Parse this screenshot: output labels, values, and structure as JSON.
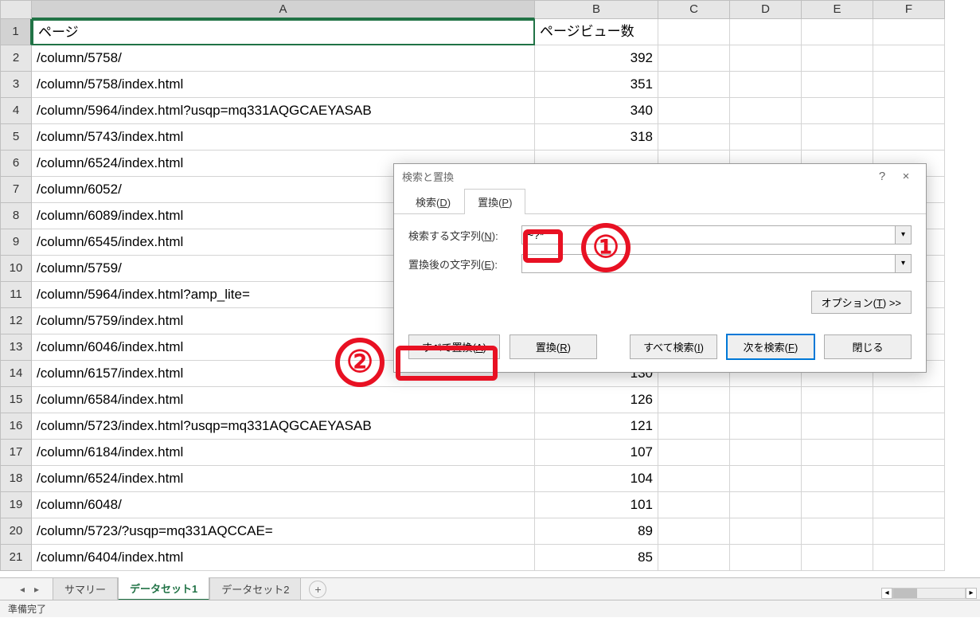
{
  "columns": [
    "A",
    "B",
    "C",
    "D",
    "E",
    "F"
  ],
  "rows": [
    {
      "n": 1,
      "a": "ページ",
      "b": "ページビュー数",
      "b_align": "left"
    },
    {
      "n": 2,
      "a": "/column/5758/",
      "b": "392"
    },
    {
      "n": 3,
      "a": "/column/5758/index.html",
      "b": "351"
    },
    {
      "n": 4,
      "a": "/column/5964/index.html?usqp=mq331AQGCAEYASAB",
      "b": "340"
    },
    {
      "n": 5,
      "a": "/column/5743/index.html",
      "b": "318"
    },
    {
      "n": 6,
      "a": "/column/6524/index.html",
      "b": ""
    },
    {
      "n": 7,
      "a": "/column/6052/",
      "b": ""
    },
    {
      "n": 8,
      "a": "/column/6089/index.html",
      "b": ""
    },
    {
      "n": 9,
      "a": "/column/6545/index.html",
      "b": ""
    },
    {
      "n": 10,
      "a": "/column/5759/",
      "b": ""
    },
    {
      "n": 11,
      "a": "/column/5964/index.html?amp_lite=",
      "b": ""
    },
    {
      "n": 12,
      "a": "/column/5759/index.html",
      "b": ""
    },
    {
      "n": 13,
      "a": "/column/6046/index.html",
      "b": ""
    },
    {
      "n": 14,
      "a": "/column/6157/index.html",
      "b": "130"
    },
    {
      "n": 15,
      "a": "/column/6584/index.html",
      "b": "126"
    },
    {
      "n": 16,
      "a": "/column/5723/index.html?usqp=mq331AQGCAEYASAB",
      "b": "121"
    },
    {
      "n": 17,
      "a": "/column/6184/index.html",
      "b": "107"
    },
    {
      "n": 18,
      "a": "/column/6524/index.html",
      "b": "104"
    },
    {
      "n": 19,
      "a": "/column/6048/",
      "b": "101"
    },
    {
      "n": 20,
      "a": "/column/5723/?usqp=mq331AQCCAE=",
      "b": "89"
    },
    {
      "n": 21,
      "a": "/column/6404/index.html",
      "b": "85"
    }
  ],
  "tabs": [
    {
      "label": "サマリー",
      "active": false
    },
    {
      "label": "データセット1",
      "active": true
    },
    {
      "label": "データセット2",
      "active": false
    }
  ],
  "status": "準備完了",
  "dialog": {
    "title": "検索と置換",
    "help": "?",
    "close": "×",
    "tabs": [
      {
        "label": "検索(D)",
        "key": "D",
        "active": false
      },
      {
        "label": "置換(P)",
        "key": "P",
        "active": true
      }
    ],
    "find_label": "検索する文字列(N):",
    "find_key": "N",
    "find_value": "~?*",
    "replace_label": "置換後の文字列(E):",
    "replace_key": "E",
    "replace_value": "",
    "options_label": "オプション(T) >>",
    "options_key": "T",
    "buttons": {
      "replace_all": "すべて置換(A)",
      "replace_all_key": "A",
      "replace": "置換(R)",
      "replace_key": "R",
      "find_all": "すべて検索(I)",
      "find_all_key": "I",
      "find_next": "次を検索(F)",
      "find_next_key": "F",
      "close": "閉じる"
    }
  },
  "annotations": {
    "one": "①",
    "two": "②"
  }
}
